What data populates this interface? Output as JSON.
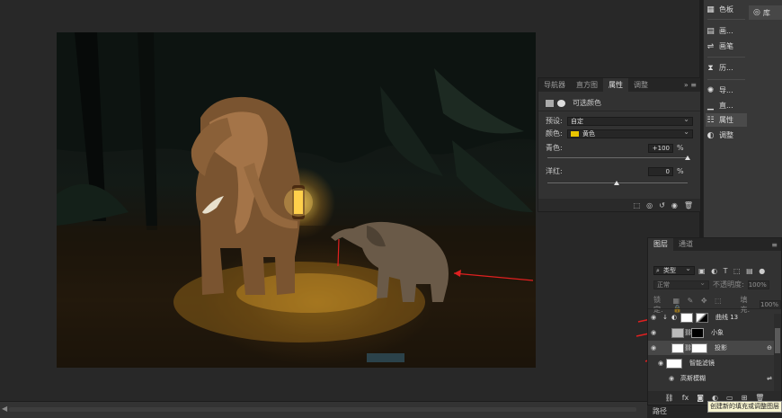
{
  "dock": {
    "items": [
      {
        "label": "色板",
        "icon": "swatches-icon"
      },
      {
        "label": "画...",
        "icon": "brush-icon"
      },
      {
        "label": "画笔",
        "icon": "brush-settings-icon"
      },
      {
        "label": "历...",
        "icon": "history-icon"
      },
      {
        "label": "导...",
        "icon": "navigator-icon"
      },
      {
        "label": "直...",
        "icon": "histogram-icon"
      },
      {
        "label": "属性",
        "icon": "properties-icon"
      },
      {
        "label": "调整",
        "icon": "adjustments-icon"
      }
    ],
    "library_label": "库"
  },
  "properties": {
    "tabs": [
      "导航器",
      "直方图",
      "属性",
      "调整"
    ],
    "active_tab": "属性",
    "title": "可选颜色",
    "preset_label": "预设:",
    "preset_value": "自定",
    "color_label": "颜色:",
    "color_value": "黄色",
    "color_swatch": "#e8c400",
    "cyan_label": "青色:",
    "cyan_value": "+100",
    "magenta_label": "洋红:",
    "magenta_value": "0",
    "percent": "%"
  },
  "layers": {
    "tabs": [
      "图层",
      "通道"
    ],
    "active_tab": "图层",
    "filter_label": "类型",
    "blend_mode": "正常",
    "opacity_label": "不透明度:",
    "opacity_value": "100%",
    "lock_label": "锁定:",
    "fill_label": "填充:",
    "fill_value": "100%",
    "rows": [
      {
        "name": "曲线 13"
      },
      {
        "name": "小象"
      },
      {
        "name": "投影"
      },
      {
        "name": "智能滤镜"
      },
      {
        "name": "高斯模糊"
      }
    ],
    "tooltip": "创建新的填充或调整图层",
    "bottom_tab": "路径"
  }
}
